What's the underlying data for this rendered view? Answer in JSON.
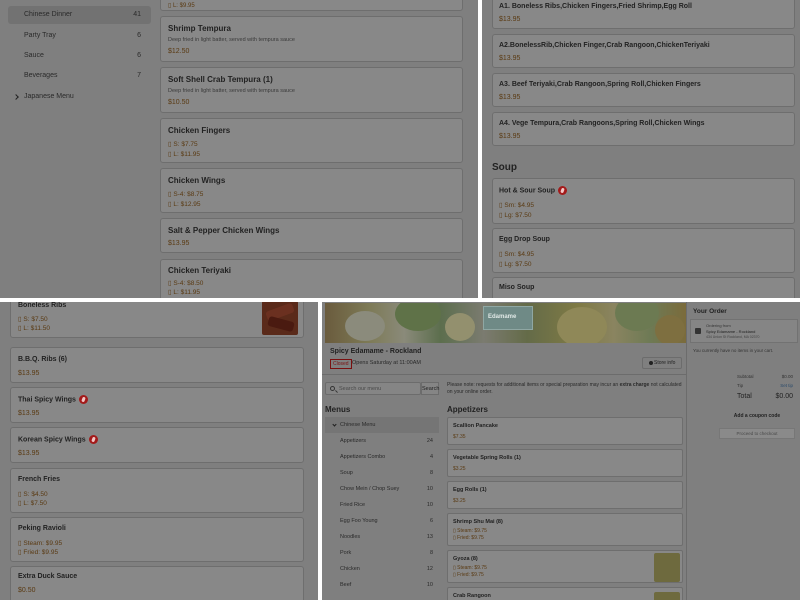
{
  "top_left": {
    "categories": [
      {
        "label": "Chinese Dinner",
        "count": "41"
      },
      {
        "label": "Party Tray",
        "count": "6"
      },
      {
        "label": "Sauce",
        "count": "6"
      },
      {
        "label": "Beverages",
        "count": "7"
      }
    ],
    "japanese_menu": "Japanese Menu",
    "items": [
      {
        "name": "Shrimp Tempura",
        "desc": "Deep fried in light batter, served with tempura sauce",
        "price": "$12.50"
      },
      {
        "name": "Soft Shell Crab Tempura (1)",
        "desc": "Deep fried in light batter, served with tempura sauce",
        "price": "$10.50"
      },
      {
        "name": "Chicken Fingers",
        "l1": "S: $7.75",
        "l2": "L: $11.95"
      },
      {
        "name": "Chicken Wings",
        "l1": "S-4: $8.75",
        "l2": "L: $12.95"
      },
      {
        "name": "Salt & Pepper Chicken Wings",
        "price": "$13.95"
      },
      {
        "name": "Chicken Teriyaki",
        "l1": "S-4: $8.50",
        "l2": "L: $11.95"
      }
    ]
  },
  "top_right": {
    "combos": [
      {
        "name": "A1. Boneless Ribs,Chicken Fingers,Fried Shrimp,Egg Roll",
        "price": "$13.95"
      },
      {
        "name": "A2.BonelessRib,Chicken Finger,Crab Rangoon,ChickenTeriyaki",
        "price": "$13.95"
      },
      {
        "name": "A3. Beef Teriyaki,Crab Rangoon,Spring Roll,Chicken Fingers",
        "price": "$13.95"
      },
      {
        "name": "A4. Vege Tempura,Crab Rangoons,Spring Roll,Chicken Wings",
        "price": "$13.95"
      }
    ],
    "soup_heading": "Soup",
    "soups": [
      {
        "name": "Hot & Sour Soup",
        "l1": "Sm: $4.95",
        "l2": "Lg: $7.50"
      },
      {
        "name": "Egg Drop Soup",
        "l1": "Sm: $4.95",
        "l2": "Lg: $7.50"
      },
      {
        "name": "Miso Soup"
      }
    ]
  },
  "bottom_left": {
    "items": [
      {
        "name": "Boneless Ribs",
        "l1": "S: $7.50",
        "l2": "L: $11.50"
      },
      {
        "name": "B.B.Q. Ribs (6)",
        "price": "$13.95"
      },
      {
        "name": "Thai Spicy Wings",
        "price": "$13.95"
      },
      {
        "name": "Korean Spicy Wings",
        "price": "$13.95"
      },
      {
        "name": "French Fries",
        "l1": "S: $4.50",
        "l2": "L: $7.50"
      },
      {
        "name": "Peking Ravioli",
        "l1": "Steam: $9.95",
        "l2": "Fried: $9.95"
      },
      {
        "name": "Extra Duck Sauce",
        "price": "$0.50"
      }
    ]
  },
  "store": {
    "logo_text": "Edamame",
    "name": "Spicy Edamame - Rockland",
    "closed_label": "Closed",
    "opens": "Opens Saturday at 11:00AM",
    "store_info": "Store info",
    "search_placeholder": "Search our menu",
    "search_button": "Search",
    "note_part1": "Please note: requests for additional items or special preparation may incur an ",
    "note_bold": "extra charge",
    "note_part2": " not calculated on your online order.",
    "menus_heading": "Menus",
    "appetizers_heading": "Appetizers",
    "menu_nav": [
      {
        "label": "Chinese Menu",
        "count": ""
      },
      {
        "label": "Appetizers",
        "count": "24"
      },
      {
        "label": "Appetizers Combo",
        "count": "4"
      },
      {
        "label": "Soup",
        "count": "8"
      },
      {
        "label": "Chow Mein / Chop Suey",
        "count": "10"
      },
      {
        "label": "Fried Rice",
        "count": "10"
      },
      {
        "label": "Egg Foo Young",
        "count": "6"
      },
      {
        "label": "Noodles",
        "count": "13"
      },
      {
        "label": "Pork",
        "count": "8"
      },
      {
        "label": "Chicken",
        "count": "12"
      },
      {
        "label": "Beef",
        "count": "10"
      }
    ],
    "appetizers": [
      {
        "name": "Scallion Pancake",
        "price": "$7.35"
      },
      {
        "name": "Vegetable Spring Rolls (1)",
        "price": "$3.25"
      },
      {
        "name": "Egg Rolls (1)",
        "price": "$3.25"
      },
      {
        "name": "Shrimp Shu Mai (8)",
        "l1": "Steam: $9.75",
        "l2": "Fried: $9.75"
      },
      {
        "name": "Gyoza (8)",
        "l1": "Steam: $9.75",
        "l2": "Fried: $9.75"
      },
      {
        "name": "Crab Rangoon"
      }
    ]
  },
  "order": {
    "title": "Your Order",
    "ordering_from": "Ordering from",
    "store_name": "Spicy Edamame - Rockland",
    "address": "434 Union St Rockland, MA 02370",
    "empty": "You currently have no items in your cart.",
    "subtotal_label": "Subtotal",
    "subtotal": "$0.00",
    "tip_label": "Tip",
    "tip_link": "Set tip",
    "total_label": "Total",
    "total": "$0.00",
    "coupon": "Add a coupon code",
    "checkout": "Proceed to checkout"
  }
}
